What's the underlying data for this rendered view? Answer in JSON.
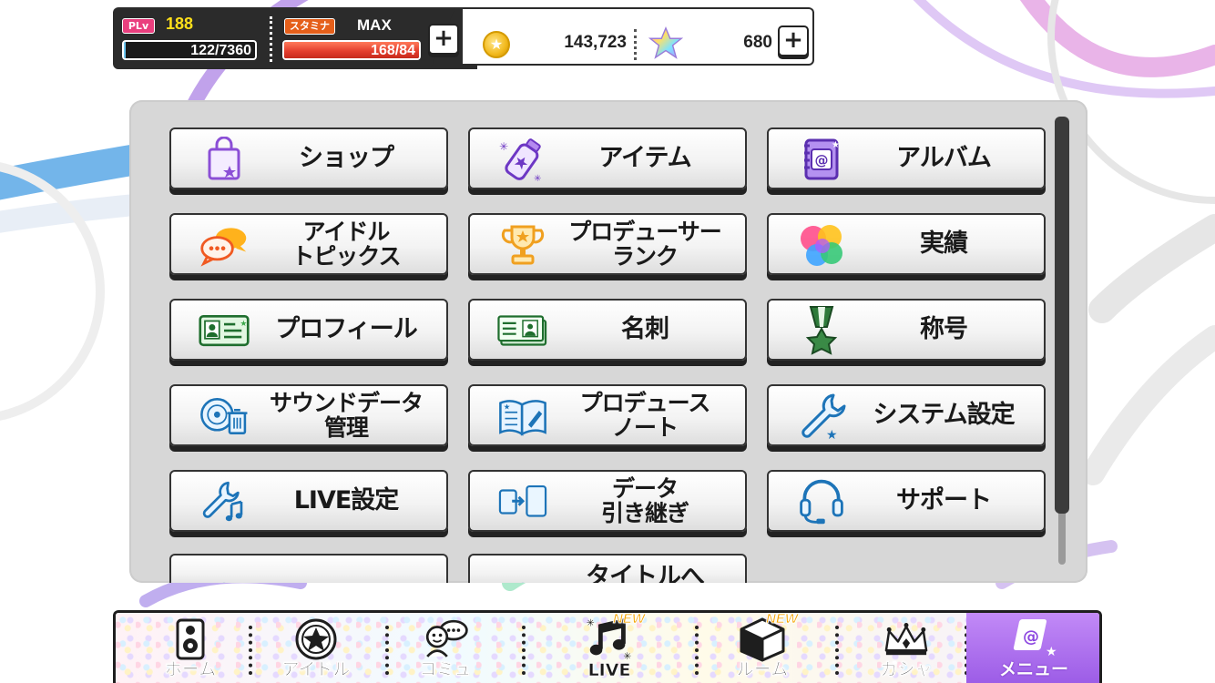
{
  "status": {
    "plv_tag": "PLv",
    "plv_value": "188",
    "xp_text": "122/7360",
    "xp_fill": 0.017,
    "stamina_tag": "スタミナ",
    "stamina_max": "MAX",
    "stamina_text": "168/84",
    "stamina_fill": 1.0,
    "money": "143,723",
    "jewels": "680",
    "plus": "+"
  },
  "menu": {
    "items": [
      {
        "label": "ショップ",
        "icon": "shopping-bag-icon"
      },
      {
        "label": "アイテム",
        "icon": "stamina-drink-icon"
      },
      {
        "label": "アルバム",
        "icon": "album-icon"
      },
      {
        "label": "アイドル\nトピックス",
        "icon": "speech-bubbles-icon"
      },
      {
        "label": "プロデューサー\nランク",
        "icon": "trophy-icon"
      },
      {
        "label": "実績",
        "icon": "game-center-icon"
      },
      {
        "label": "プロフィール",
        "icon": "profile-card-icon"
      },
      {
        "label": "名刺",
        "icon": "business-card-icon"
      },
      {
        "label": "称号",
        "icon": "medal-icon"
      },
      {
        "label": "サウンドデータ\n管理",
        "icon": "disc-trash-icon"
      },
      {
        "label": "プロデュース\nノート",
        "icon": "notebook-icon"
      },
      {
        "label": "システム設定",
        "icon": "wrench-icon"
      },
      {
        "label": "LIVE設定",
        "icon": "wrench-music-icon"
      },
      {
        "label": "データ\n引き継ぎ",
        "icon": "data-transfer-icon"
      },
      {
        "label": "サポート",
        "icon": "headset-icon"
      },
      {
        "label": "",
        "icon": "partial-icon"
      },
      {
        "label": "タイトルへ",
        "icon": "partial-icon"
      }
    ]
  },
  "nav": {
    "items": [
      {
        "label": "ホーム",
        "icon": "home-speaker-icon"
      },
      {
        "label": "アイドル",
        "icon": "idol-star-icon"
      },
      {
        "label": "コミュ",
        "icon": "commu-chat-icon"
      },
      {
        "label": "LIVE",
        "icon": "music-note-icon",
        "badge": "NEW"
      },
      {
        "label": "ルーム",
        "icon": "room-cube-icon",
        "badge": "NEW"
      },
      {
        "label": "ガシャ",
        "icon": "crown-icon"
      },
      {
        "label": "メニュー",
        "icon": "menu-icon"
      }
    ]
  },
  "colors": {
    "accent": "#9b5be6",
    "button_border": "#333333",
    "panel": "#d7d7d7"
  }
}
